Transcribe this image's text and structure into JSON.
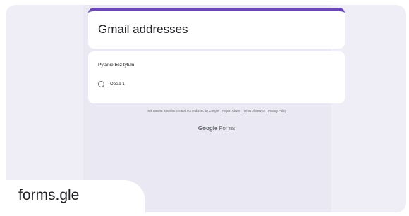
{
  "form": {
    "title": "Gmail addresses",
    "question": "Pytanie bez tytułu",
    "option": "Opcja 1",
    "disclaimer": "This content is neither created nor endorsed by Google.",
    "links": [
      "Report Abuse",
      "Terms of Service",
      "Privacy Policy"
    ],
    "brand_google": "Google",
    "brand_forms": "Forms",
    "accent_color": "#6a46b8"
  },
  "preview": {
    "domain": "forms.gle"
  }
}
